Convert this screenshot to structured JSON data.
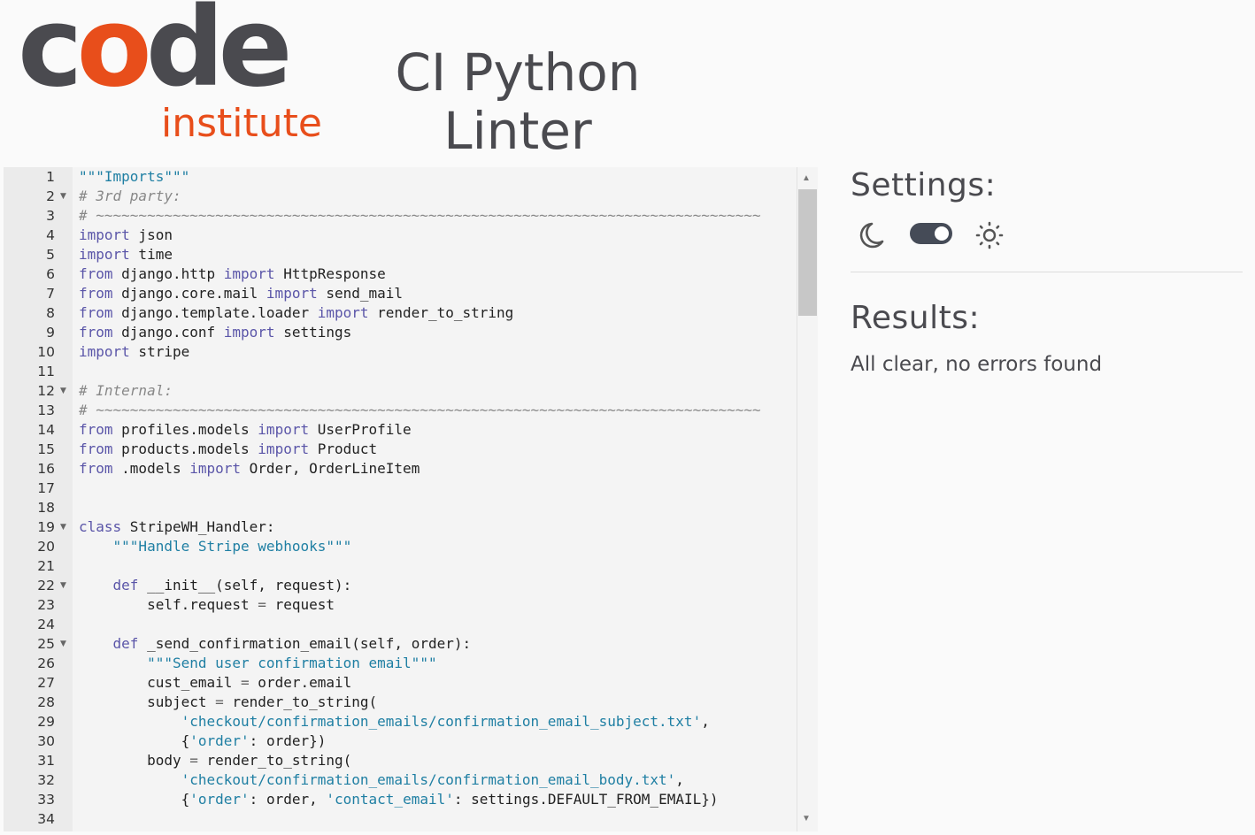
{
  "header": {
    "logo": {
      "text_c": "c",
      "text_o": "o",
      "text_de": "de",
      "sub": "institute"
    },
    "title_line1": "CI Python",
    "title_line2": "Linter"
  },
  "editor": {
    "lines": [
      {
        "n": "1",
        "fold": false,
        "tokens": [
          {
            "t": "\"\"\"Imports\"\"\"",
            "c": "str"
          }
        ]
      },
      {
        "n": "2",
        "fold": true,
        "tokens": [
          {
            "t": "# 3rd party:",
            "c": "cm"
          }
        ]
      },
      {
        "n": "3",
        "fold": false,
        "tokens": [
          {
            "t": "# ~~~~~~~~~~~~~~~~~~~~~~~~~~~~~~~~~~~~~~~~~~~~~~~~~~~~~~~~~~~~~~~~~~~~~~~~~~~~~~",
            "c": "cm"
          }
        ]
      },
      {
        "n": "4",
        "fold": false,
        "tokens": [
          {
            "t": "import",
            "c": "kw"
          },
          {
            "t": " json",
            "c": ""
          }
        ]
      },
      {
        "n": "5",
        "fold": false,
        "tokens": [
          {
            "t": "import",
            "c": "kw"
          },
          {
            "t": " time",
            "c": ""
          }
        ]
      },
      {
        "n": "6",
        "fold": false,
        "tokens": [
          {
            "t": "from",
            "c": "kw"
          },
          {
            "t": " django.http ",
            "c": ""
          },
          {
            "t": "import",
            "c": "kw"
          },
          {
            "t": " HttpResponse",
            "c": ""
          }
        ]
      },
      {
        "n": "7",
        "fold": false,
        "tokens": [
          {
            "t": "from",
            "c": "kw"
          },
          {
            "t": " django.core.mail ",
            "c": ""
          },
          {
            "t": "import",
            "c": "kw"
          },
          {
            "t": " send_mail",
            "c": ""
          }
        ]
      },
      {
        "n": "8",
        "fold": false,
        "tokens": [
          {
            "t": "from",
            "c": "kw"
          },
          {
            "t": " django.template.loader ",
            "c": ""
          },
          {
            "t": "import",
            "c": "kw"
          },
          {
            "t": " render_to_string",
            "c": ""
          }
        ]
      },
      {
        "n": "9",
        "fold": false,
        "tokens": [
          {
            "t": "from",
            "c": "kw"
          },
          {
            "t": " django.conf ",
            "c": ""
          },
          {
            "t": "import",
            "c": "kw"
          },
          {
            "t": " settings",
            "c": ""
          }
        ]
      },
      {
        "n": "10",
        "fold": false,
        "tokens": [
          {
            "t": "import",
            "c": "kw"
          },
          {
            "t": " stripe",
            "c": ""
          }
        ]
      },
      {
        "n": "11",
        "fold": false,
        "tokens": []
      },
      {
        "n": "12",
        "fold": true,
        "tokens": [
          {
            "t": "# Internal:",
            "c": "cm"
          }
        ]
      },
      {
        "n": "13",
        "fold": false,
        "tokens": [
          {
            "t": "# ~~~~~~~~~~~~~~~~~~~~~~~~~~~~~~~~~~~~~~~~~~~~~~~~~~~~~~~~~~~~~~~~~~~~~~~~~~~~~~",
            "c": "cm"
          }
        ]
      },
      {
        "n": "14",
        "fold": false,
        "tokens": [
          {
            "t": "from",
            "c": "kw"
          },
          {
            "t": " profiles.models ",
            "c": ""
          },
          {
            "t": "import",
            "c": "kw"
          },
          {
            "t": " UserProfile",
            "c": ""
          }
        ]
      },
      {
        "n": "15",
        "fold": false,
        "tokens": [
          {
            "t": "from",
            "c": "kw"
          },
          {
            "t": " products.models ",
            "c": ""
          },
          {
            "t": "import",
            "c": "kw"
          },
          {
            "t": " Product",
            "c": ""
          }
        ]
      },
      {
        "n": "16",
        "fold": false,
        "tokens": [
          {
            "t": "from",
            "c": "kw"
          },
          {
            "t": " .models ",
            "c": ""
          },
          {
            "t": "import",
            "c": "kw"
          },
          {
            "t": " Order, OrderLineItem",
            "c": ""
          }
        ]
      },
      {
        "n": "17",
        "fold": false,
        "tokens": []
      },
      {
        "n": "18",
        "fold": false,
        "tokens": []
      },
      {
        "n": "19",
        "fold": true,
        "tokens": [
          {
            "t": "class",
            "c": "kw"
          },
          {
            "t": " StripeWH_Handler:",
            "c": ""
          }
        ]
      },
      {
        "n": "20",
        "fold": false,
        "tokens": [
          {
            "t": "    ",
            "c": ""
          },
          {
            "t": "\"\"\"Handle Stripe webhooks\"\"\"",
            "c": "str"
          }
        ]
      },
      {
        "n": "21",
        "fold": false,
        "tokens": []
      },
      {
        "n": "22",
        "fold": true,
        "tokens": [
          {
            "t": "    ",
            "c": ""
          },
          {
            "t": "def",
            "c": "kw"
          },
          {
            "t": " __init__(self, request):",
            "c": ""
          }
        ]
      },
      {
        "n": "23",
        "fold": false,
        "tokens": [
          {
            "t": "        self.request ",
            "c": ""
          },
          {
            "t": "=",
            "c": "op"
          },
          {
            "t": " request",
            "c": ""
          }
        ]
      },
      {
        "n": "24",
        "fold": false,
        "tokens": []
      },
      {
        "n": "25",
        "fold": true,
        "tokens": [
          {
            "t": "    ",
            "c": ""
          },
          {
            "t": "def",
            "c": "kw"
          },
          {
            "t": " _send_confirmation_email(self, order):",
            "c": ""
          }
        ]
      },
      {
        "n": "26",
        "fold": false,
        "tokens": [
          {
            "t": "        ",
            "c": ""
          },
          {
            "t": "\"\"\"Send user confirmation email\"\"\"",
            "c": "str"
          }
        ]
      },
      {
        "n": "27",
        "fold": false,
        "tokens": [
          {
            "t": "        cust_email ",
            "c": ""
          },
          {
            "t": "=",
            "c": "op"
          },
          {
            "t": " order.email",
            "c": ""
          }
        ]
      },
      {
        "n": "28",
        "fold": false,
        "tokens": [
          {
            "t": "        subject ",
            "c": ""
          },
          {
            "t": "=",
            "c": "op"
          },
          {
            "t": " render_to_string(",
            "c": ""
          }
        ]
      },
      {
        "n": "29",
        "fold": false,
        "tokens": [
          {
            "t": "            ",
            "c": ""
          },
          {
            "t": "'checkout/confirmation_emails/confirmation_email_subject.txt'",
            "c": "str"
          },
          {
            "t": ",",
            "c": ""
          }
        ]
      },
      {
        "n": "30",
        "fold": false,
        "tokens": [
          {
            "t": "            {",
            "c": ""
          },
          {
            "t": "'order'",
            "c": "str"
          },
          {
            "t": ": order})",
            "c": ""
          }
        ]
      },
      {
        "n": "31",
        "fold": false,
        "tokens": [
          {
            "t": "        body ",
            "c": ""
          },
          {
            "t": "=",
            "c": "op"
          },
          {
            "t": " render_to_string(",
            "c": ""
          }
        ]
      },
      {
        "n": "32",
        "fold": false,
        "tokens": [
          {
            "t": "            ",
            "c": ""
          },
          {
            "t": "'checkout/confirmation_emails/confirmation_email_body.txt'",
            "c": "str"
          },
          {
            "t": ",",
            "c": ""
          }
        ]
      },
      {
        "n": "33",
        "fold": false,
        "tokens": [
          {
            "t": "            {",
            "c": ""
          },
          {
            "t": "'order'",
            "c": "str"
          },
          {
            "t": ": order, ",
            "c": ""
          },
          {
            "t": "'contact_email'",
            "c": "str"
          },
          {
            "t": ": settings.DEFAULT_FROM_EMAIL})",
            "c": ""
          }
        ]
      },
      {
        "n": "34",
        "fold": false,
        "tokens": []
      }
    ]
  },
  "settings": {
    "title": "Settings:",
    "dark_icon": "moon-icon",
    "light_icon": "sun-icon",
    "toggle_state": "light"
  },
  "results": {
    "title": "Results:",
    "message": "All clear, no errors found"
  },
  "colors": {
    "brand_orange": "#e84e1b",
    "brand_grey": "#4a4a4f",
    "keyword": "#5a55a8",
    "string": "#1f7fa3",
    "comment": "#888888"
  }
}
